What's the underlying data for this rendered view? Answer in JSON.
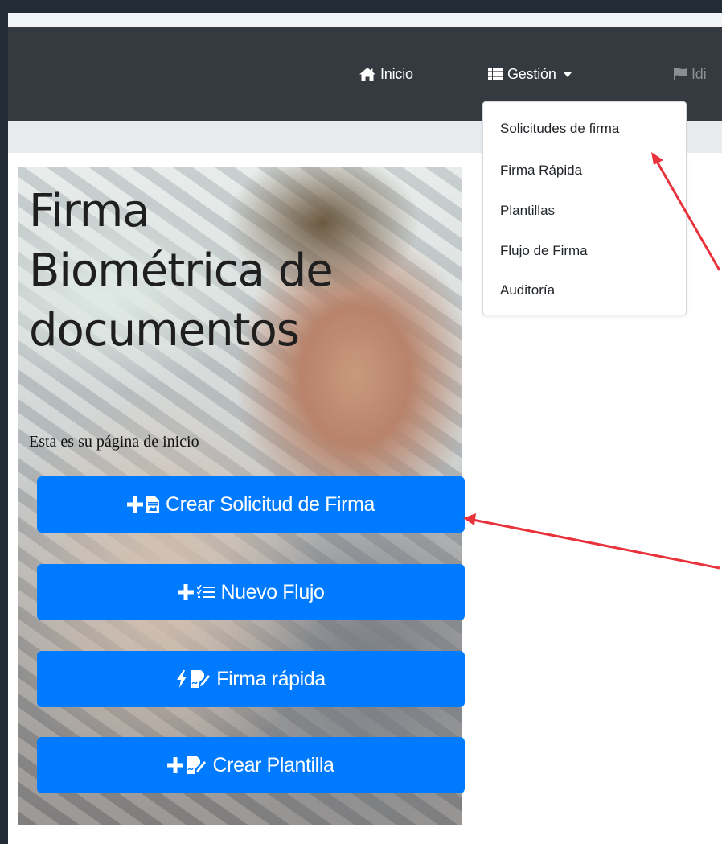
{
  "navbar": {
    "items": [
      {
        "label": "Inicio",
        "icon": "home-icon"
      },
      {
        "label": "Gestión",
        "icon": "list-icon"
      },
      {
        "label": "Idi",
        "icon": "flag-icon"
      }
    ]
  },
  "dropdown": {
    "items": [
      {
        "label": "Solicitudes de firma"
      },
      {
        "label": "Firma Rápida"
      },
      {
        "label": "Plantillas"
      },
      {
        "label": "Flujo de Firma"
      },
      {
        "label": "Auditoría"
      }
    ]
  },
  "hero": {
    "title_lines": [
      "Firma",
      "Biométrica de",
      "documentos"
    ],
    "subtitle": "Esta es su página de inicio"
  },
  "buttons": [
    {
      "label": "Crear Solicitud de Firma",
      "icons": [
        "plus-icon",
        "pdf-document-icon"
      ]
    },
    {
      "label": "Nuevo Flujo",
      "icons": [
        "plus-icon",
        "checklist-icon"
      ]
    },
    {
      "label": "Firma rápida",
      "icons": [
        "lightning-icon",
        "signature-icon"
      ]
    },
    {
      "label": "Crear Plantilla",
      "icons": [
        "plus-icon",
        "signature-icon"
      ]
    }
  ],
  "colors": {
    "navbar": "#343a40",
    "primary": "#007bff",
    "annotation_arrow": "#e8323c"
  }
}
